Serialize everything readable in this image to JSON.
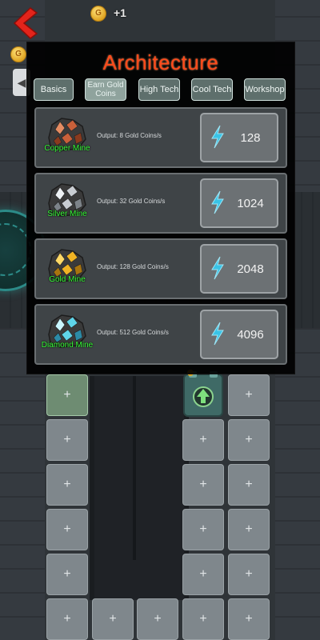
{
  "header": {
    "coin_letter": "G",
    "plus_text": "+1"
  },
  "side": {
    "coin_letter": "G",
    "tab_glyph": "◀"
  },
  "modal": {
    "title": "Architecture",
    "tabs": [
      {
        "label": "Basics"
      },
      {
        "label": "Earn Gold Coins",
        "active": true
      },
      {
        "label": "High Tech"
      },
      {
        "label": "Cool Tech"
      },
      {
        "label": "Workshop"
      }
    ],
    "items": [
      {
        "name": "Copper Mine",
        "output": "Output: 8 Gold Coins/s",
        "price": "128",
        "icon": "copper-ore-icon",
        "colors": [
          "#c9603a",
          "#e58c62",
          "#8a3a1e"
        ]
      },
      {
        "name": "Silver Mine",
        "output": "Output: 32 Gold Coins/s",
        "price": "1024",
        "icon": "silver-ore-icon",
        "colors": [
          "#c9cdd2",
          "#eef1f4",
          "#7d8389"
        ]
      },
      {
        "name": "Gold Mine",
        "output": "Output: 128 Gold Coins/s",
        "price": "2048",
        "icon": "gold-ore-icon",
        "colors": [
          "#f0b324",
          "#ffd866",
          "#a8740f"
        ]
      },
      {
        "name": "Diamond Mine",
        "output": "Output: 512 Gold Coins/s",
        "price": "4096",
        "icon": "diamond-ore-icon",
        "colors": [
          "#5fd4e8",
          "#c9f6ff",
          "#2c8aa6"
        ]
      }
    ]
  },
  "grid": {
    "slot_glyph": "+"
  },
  "colors": {
    "title": "#ff4a1a",
    "name_label": "#3aff3a",
    "bolt": "#39c3e6"
  }
}
